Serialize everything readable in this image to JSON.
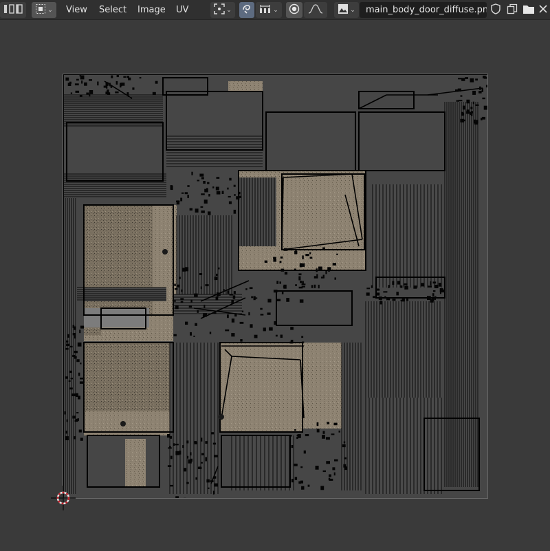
{
  "header": {
    "menus": [
      "View",
      "Select",
      "Image",
      "UV"
    ],
    "image_name": "main_body_door_diffuse.png"
  },
  "icons": {
    "editor_type": "uv-editor-icon",
    "sidebar_toggle": "sidebar-icon",
    "select_mode": "select-mode-icon",
    "pivot": "pivot-point-icon",
    "sticky": "sticky-select-icon",
    "snap": "snap-icon",
    "proportional": "proportional-edit-icon",
    "falloff": "falloff-curve-icon",
    "image_browse": "image-browse-icon",
    "fake_user": "shield-icon",
    "duplicate": "duplicate-icon",
    "open": "folder-icon",
    "close": "close-icon"
  },
  "colors": {
    "background": "#3a3a3a",
    "header": "#303030",
    "texture": "#8c8170",
    "wire": "#000000",
    "uv_empty": "#464646"
  }
}
